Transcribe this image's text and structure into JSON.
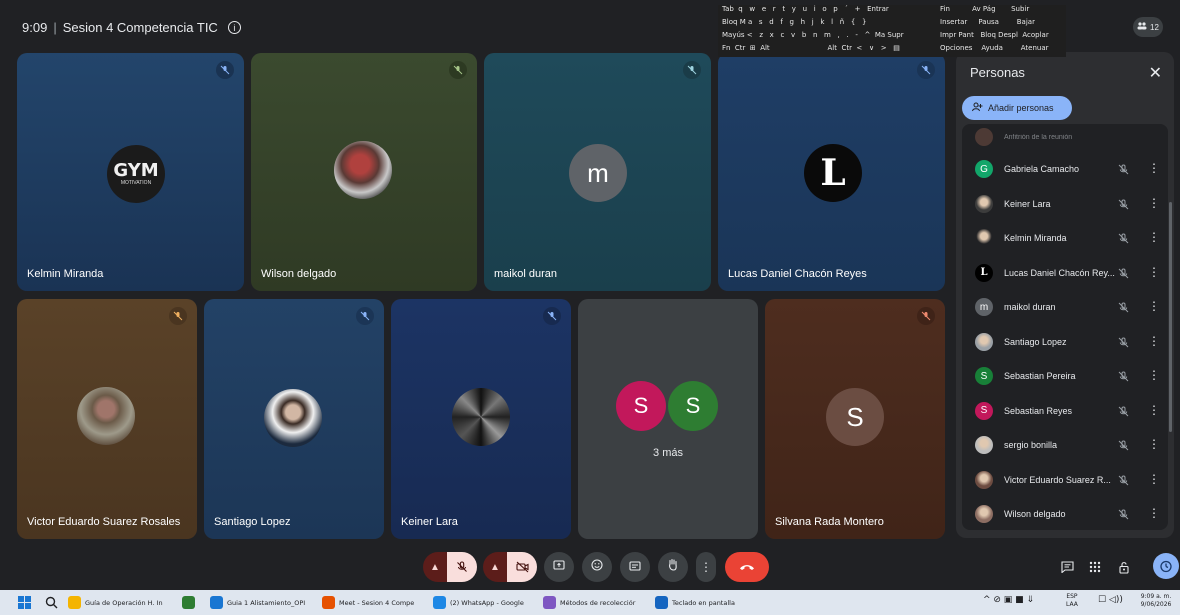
{
  "meeting": {
    "time": "9:09",
    "title": "Sesion 4 Competencia TIC"
  },
  "participants_badge": {
    "count": "12"
  },
  "tiles": [
    {
      "name": "Kelmin Miranda",
      "bg": "#1f3a5f",
      "avatar": "gym-logo-photo",
      "avatar_text": "GYM",
      "avatar_subtext": "MOTIVATION"
    },
    {
      "name": "Wilson delgado",
      "bg": "#34402a",
      "avatar": "person-photo"
    },
    {
      "name": "maikol duran",
      "bg": "#1d4150",
      "avatar": "letter",
      "letter": "m"
    },
    {
      "name": "Lucas Daniel Chacón Reyes",
      "bg": "#1b3a60",
      "avatar": "letter-serif",
      "letter": "L"
    },
    {
      "name": "Victor Eduardo Suarez Rosales",
      "bg": "#4f3a22",
      "avatar": "person-photo"
    },
    {
      "name": "Santiago Lopez",
      "bg": "#1f3a60",
      "avatar": "person-photo"
    },
    {
      "name": "Keiner Lara",
      "bg": "#1a2d5a",
      "avatar": "abstract-photo"
    },
    {
      "name": "",
      "bg": "#3c4043",
      "avatar": "group",
      "letters": [
        "S",
        "S"
      ],
      "more": "3 más"
    },
    {
      "name": "Silvana Rada Montero",
      "bg": "#4a2a1c",
      "avatar": "letter",
      "letter": "S"
    }
  ],
  "people_panel": {
    "title": "Personas",
    "add_button": "Añadir personas",
    "host_label": "Anfitrión de la reunión",
    "people": [
      {
        "name": "Gabriela Camacho",
        "avatar": "G",
        "color": "#12a66a"
      },
      {
        "name": "Keiner Lara",
        "avatar": "photo",
        "color": "#3c3c3c"
      },
      {
        "name": "Kelmin Miranda",
        "avatar": "photo",
        "color": "#202124"
      },
      {
        "name": "Lucas Daniel Chacón Rey...",
        "avatar": "L",
        "color": "#000000"
      },
      {
        "name": "maikol duran",
        "avatar": "m",
        "color": "#5f6368"
      },
      {
        "name": "Santiago Lopez",
        "avatar": "photo",
        "color": "#9aa0a6"
      },
      {
        "name": "Sebastian Pereira",
        "avatar": "S",
        "color": "#188038"
      },
      {
        "name": "Sebastian Reyes",
        "avatar": "S",
        "color": "#c2185b"
      },
      {
        "name": "sergio bonilla",
        "avatar": "photo",
        "color": "#bdbdbd"
      },
      {
        "name": "Victor Eduardo Suarez R...",
        "avatar": "photo",
        "color": "#6d4c41"
      },
      {
        "name": "Wilson delgado",
        "avatar": "photo",
        "color": "#8d6e63"
      }
    ]
  },
  "keyboard": {
    "rows": [
      "Tab  q   w   e   r   t   y   u   i   o   p   ´   +   Entrar",
      "Bloq M a   s   d   f   g   h   j   k   l   ñ   {   }",
      "Mayús <   z   x   c   v   b   n   m   ,   .   -   ^  Ma Supr",
      "Fn  Ctr  ⊞  Alt                          Alt  Ctr  <   ∨   >   ▤"
    ],
    "right_rows": [
      "Fin          Av Pág       Subir",
      "Insertar     Pausa        Bajar",
      "Impr Pant   Bloq Despl  Acoplar",
      "Opciones    Ayuda        Atenuar"
    ]
  },
  "taskbar": {
    "items": [
      {
        "label": "Guía de Operación H. In",
        "color": "#f4b400"
      },
      {
        "label": "",
        "color": "#2e7d32"
      },
      {
        "label": "Guia 1 Alistamiento_OPI",
        "color": "#1976d2"
      },
      {
        "label": "Meet - Sesion 4 Compe",
        "color": "#e65100"
      },
      {
        "label": "(2) WhatsApp - Google",
        "color": "#1e88e5"
      },
      {
        "label": "Métodos de recolecciór",
        "color": "#7e57c2"
      },
      {
        "label": "Teclado en pantalla",
        "color": "#1565c0"
      }
    ],
    "lang": "ESP",
    "lang2": "LAA",
    "time": "9:09 a. m.",
    "date": "9/06/2026"
  }
}
